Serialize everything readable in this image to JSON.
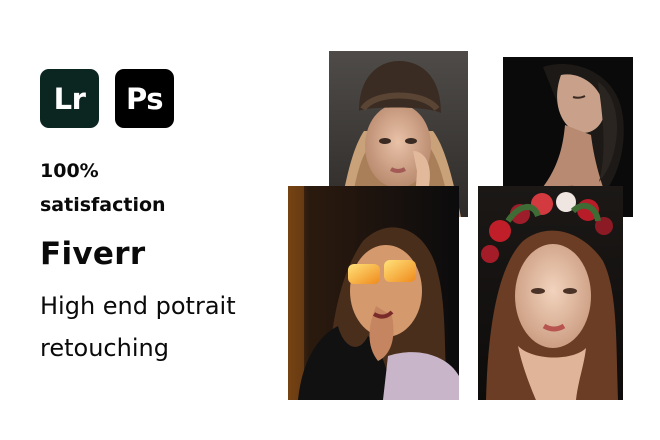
{
  "logos": {
    "lightroom": "Lr",
    "photoshop": "Ps"
  },
  "headline": {
    "line1": "100%",
    "line2": "satisfaction"
  },
  "brand": "Fiverr",
  "tagline": {
    "line1": "High end potrait",
    "line2": "retouching"
  },
  "colors": {
    "lightroom_bg": "#0b2521",
    "photoshop_bg": "#000000",
    "text": "#0a0a0a",
    "background": "#ffffff"
  }
}
